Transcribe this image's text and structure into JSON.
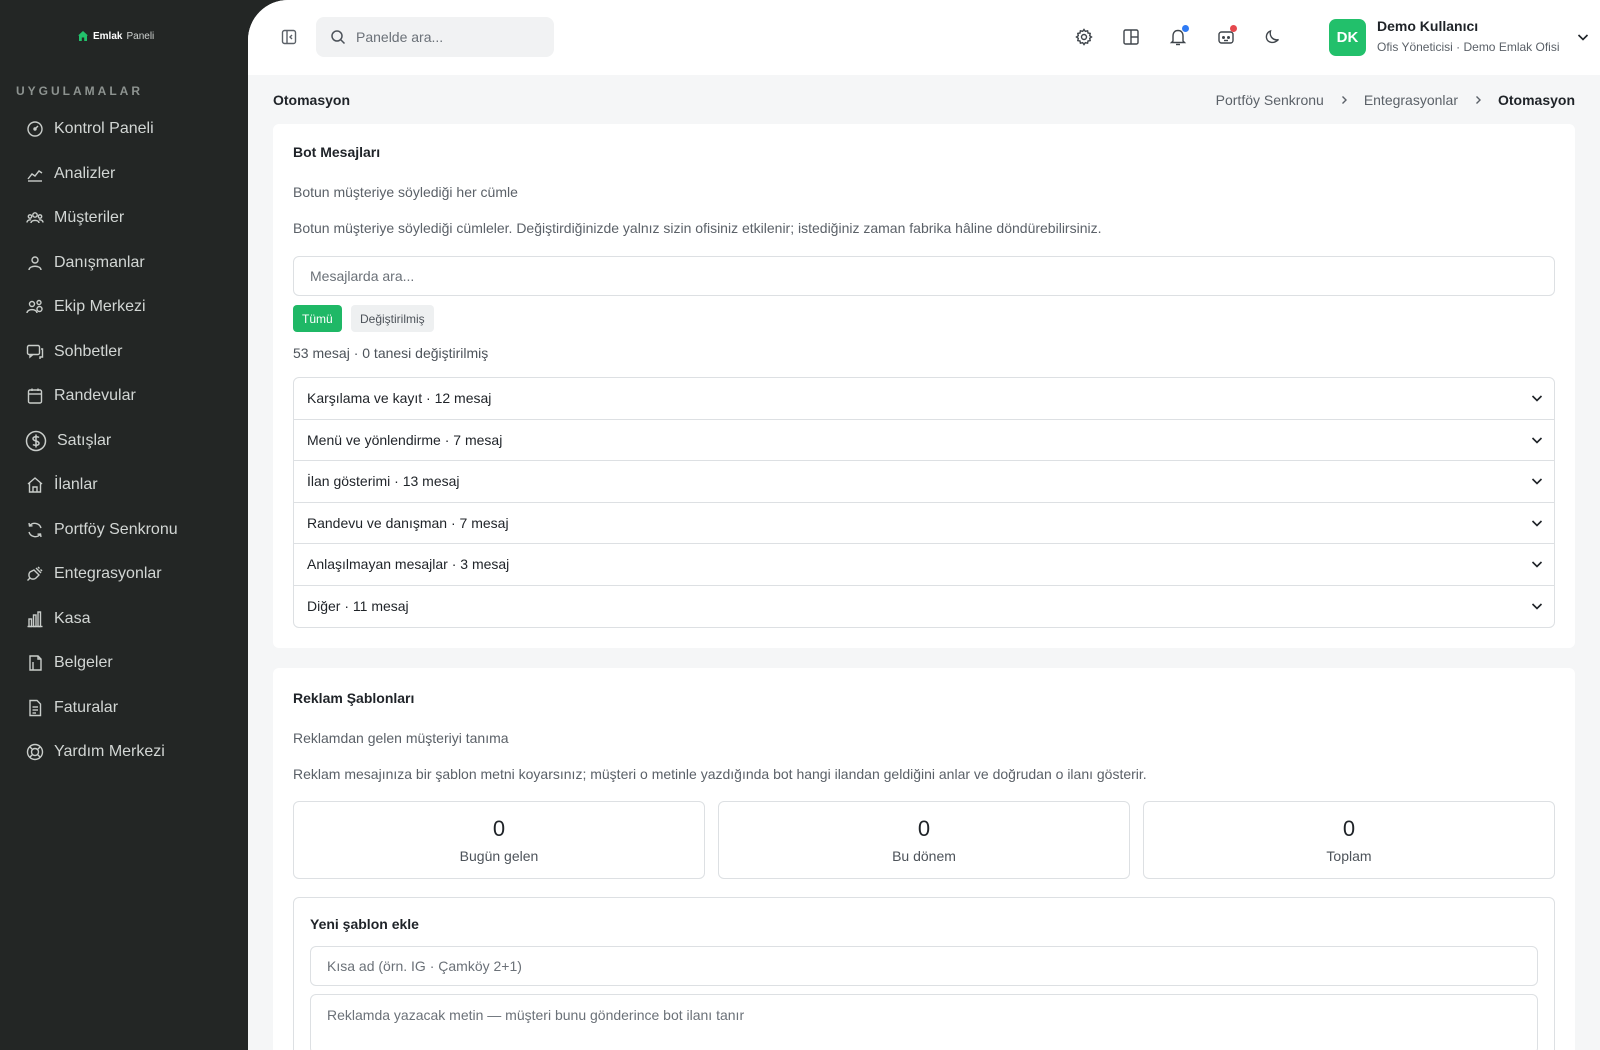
{
  "brand": {
    "name_bold": "Emlak",
    "name_light": "Paneli",
    "icon": "house-icon",
    "accent_color": "#22c06b"
  },
  "sidebar": {
    "section_label": "UYGULAMALAR",
    "items": [
      {
        "label": "Kontrol Paneli",
        "icon": "dashboard-gauge-icon"
      },
      {
        "label": "Analizler",
        "icon": "chart-line-icon"
      },
      {
        "label": "Müşteriler",
        "icon": "users-group-icon"
      },
      {
        "label": "Danışmanlar",
        "icon": "user-icon"
      },
      {
        "label": "Ekip Merkezi",
        "icon": "users-cog-icon"
      },
      {
        "label": "Sohbetler",
        "icon": "chat-icon"
      },
      {
        "label": "Randevular",
        "icon": "calendar-icon"
      },
      {
        "label": "Satışlar",
        "icon": "dollar-circle-icon"
      },
      {
        "label": "İlanlar",
        "icon": "home-icon"
      },
      {
        "label": "Portföy Senkronu",
        "icon": "sync-icon"
      },
      {
        "label": "Entegrasyonlar",
        "icon": "plug-icon"
      },
      {
        "label": "Kasa",
        "icon": "bar-chart-icon"
      },
      {
        "label": "Belgeler",
        "icon": "document-icon"
      },
      {
        "label": "Faturalar",
        "icon": "invoice-icon"
      },
      {
        "label": "Yardım Merkezi",
        "icon": "lifebuoy-icon"
      }
    ]
  },
  "topbar": {
    "search_placeholder": "Panelde ara...",
    "icons": [
      "settings-icon",
      "layout-icon",
      "bell-icon",
      "bot-icon",
      "moon-icon"
    ],
    "notification_dot_color": "#2f7bf5",
    "bot_dot_color": "#e5484d",
    "user": {
      "initials": "DK",
      "name": "Demo Kullanıcı",
      "role": "Ofis Yöneticisi · Demo Emlak Ofisi"
    }
  },
  "page": {
    "title": "Otomasyon",
    "breadcrumb": [
      "Portföy Senkronu",
      "Entegrasyonlar",
      "Otomasyon"
    ]
  },
  "bot_messages": {
    "title": "Bot Mesajları",
    "subtitle": "Botun müşteriye söylediği her cümle",
    "description": "Botun müşteriye söylediği cümleler. Değiştirdiğinizde yalnız sizin ofisiniz etkilenir; istediğiniz zaman fabrika hâline döndürebilirsiniz.",
    "search_placeholder": "Mesajlarda ara...",
    "filters": {
      "all": "Tümü",
      "modified": "Değiştirilmiş"
    },
    "count_text": "53 mesaj · 0 tanesi değiştirilmiş",
    "groups": [
      "Karşılama ve kayıt · 12 mesaj",
      "Menü ve yönlendirme · 7 mesaj",
      "İlan gösterimi · 13 mesaj",
      "Randevu ve danışman · 7 mesaj",
      "Anlaşılmayan mesajlar · 3 mesaj",
      "Diğer · 11 mesaj"
    ]
  },
  "ad_templates": {
    "title": "Reklam Şablonları",
    "subtitle": "Reklamdan gelen müşteriyi tanıma",
    "description": "Reklam mesajınıza bir şablon metni koyarsınız; müşteri o metinle yazdığında bot hangi ilandan geldiğini anlar ve doğrudan o ilanı gösterir.",
    "stats": [
      {
        "value": "0",
        "label": "Bugün gelen"
      },
      {
        "value": "0",
        "label": "Bu dönem"
      },
      {
        "value": "0",
        "label": "Toplam"
      }
    ],
    "new_template": {
      "title": "Yeni şablon ekle",
      "name_placeholder": "Kısa ad (örn. IG · Çamköy 2+1)",
      "text_placeholder": "Reklamda yazacak metin — müşteri bunu gönderince bot ilanı tanır"
    }
  }
}
